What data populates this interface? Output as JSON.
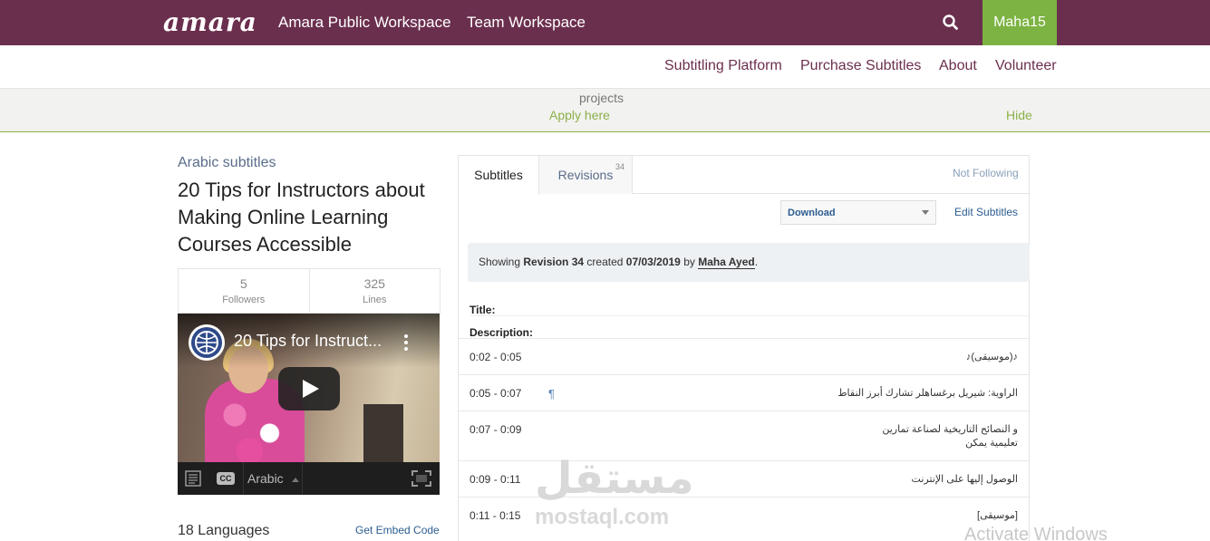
{
  "topbar": {
    "logo": "amara",
    "nav": [
      "Amara Public Workspace",
      "Team Workspace"
    ],
    "user": "Maha15",
    "bg_color": "#6b2f4e",
    "user_color": "#7cb342",
    "search_icon": "search-icon"
  },
  "subnav": {
    "items": [
      "Subtitling Platform",
      "Purchase Subtitles",
      "About",
      "Volunteer"
    ]
  },
  "banner": {
    "projects": "projects",
    "apply": "Apply here",
    "hide": "Hide",
    "accent_color": "#8bb04a"
  },
  "video": {
    "language_label": "Arabic subtitles",
    "title": "20 Tips for Instructors about Making Online Learning Courses Accessible",
    "stats": [
      {
        "value": "5",
        "label": "Followers"
      },
      {
        "value": "325",
        "label": "Lines"
      }
    ],
    "player": {
      "title": "20 Tips for Instruct...",
      "subtitle_language": "Arabic",
      "cc_label": "CC"
    },
    "languages_count": "18 Languages",
    "embed_link": "Get Embed Code"
  },
  "panel": {
    "tabs": [
      {
        "label": "Subtitles",
        "active": true
      },
      {
        "label": "Revisions",
        "badge": "34"
      }
    ],
    "follow_status": "Not Following",
    "download_label": "Download",
    "edit_label": "Edit Subtitles",
    "revision": {
      "prefix": "Showing",
      "revision": "Revision 34",
      "created_prefix": "created",
      "date": "07/03/2019",
      "by": "by",
      "author": "Maha Ayed",
      "suffix": "."
    },
    "title_label": "Title:",
    "description_label": "Description:",
    "subtitles": [
      {
        "time": "0:02 - 0:05",
        "text": "♪(موسيقى)♪"
      },
      {
        "time": "0:05 - 0:07",
        "text": "الراوية: شيريل برغساهلر تشارك أبرز النقاط",
        "pilcrow": "¶"
      },
      {
        "time": "0:07 - 0:09",
        "text": "و النصائح التاريخية لصناعة تمارين تعليمية يمكن"
      },
      {
        "time": "0:09 - 0:11",
        "text": "الوصول إليها على الإنترنت"
      },
      {
        "time": "0:11 - 0:15",
        "text": "[موسيقى]"
      }
    ]
  },
  "overlays": {
    "watermark_ar": "مستقل",
    "watermark_en": "mostaql.com",
    "activate": "Activate Windows"
  }
}
